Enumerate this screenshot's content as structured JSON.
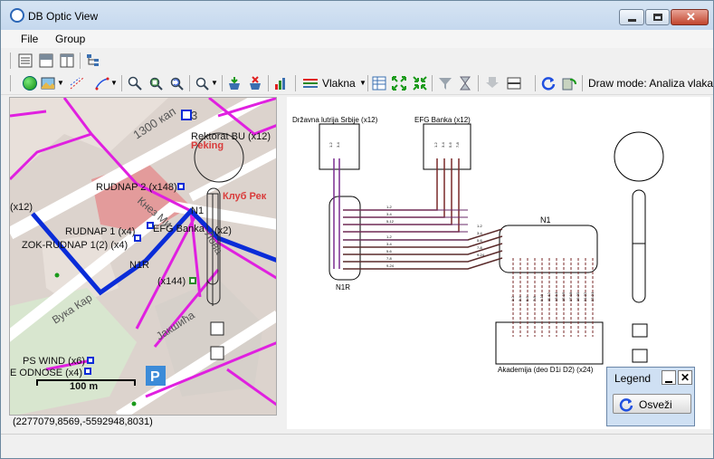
{
  "window": {
    "title": "DB Optic View"
  },
  "menu": [
    {
      "label": "File"
    },
    {
      "label": "Group"
    }
  ],
  "toolbar": {
    "vlakna_label": "Vlakna",
    "draw_mode": "Draw mode: Analiza vlaka"
  },
  "map": {
    "labels": {
      "rektorat": "Rektorat BU (x12)",
      "rudnap2": "RUDNAP 2 (x148)",
      "rudnap1": "RUDNAP 1 (x4)",
      "zok": "ZOK-RUDNAP 1(2) (x4)",
      "efg": "EFG Banka",
      "n1": "N1",
      "n1r": "N1R",
      "x144": "(x144)",
      "x12left": "(x12)",
      "x2": "(x2)",
      "pswind": "PS WIND (x6)",
      "odnose": "E ODNOSE (x4)",
      "num3": "3",
      "peking": "Peking",
      "klub": "Клуб Рек",
      "street1": "1300 кап",
      "street2": "Кнез Ми",
      "street3": "Вука Кар",
      "street4": "Јакшића",
      "street5": "Лова",
      "scale": "100 m"
    },
    "coordinates": "(2277079,8569,-5592948,8031)"
  },
  "schematic": {
    "nodes": {
      "lutrija": "Državna lutrija Srbije (x12)",
      "efg": "EFG Banka (x12)",
      "n1": "N1",
      "n1r": "N1R",
      "akademija": "Akademija (deo D1i D2) (x24)"
    },
    "fiber_labels": [
      "1-2",
      "3-4",
      "5-12",
      "1-2",
      "3-4",
      "5-6",
      "7-8",
      "9-24"
    ],
    "n1_labels": [
      "1-2",
      "3-4",
      "5-6",
      "7-8",
      "9-24"
    ],
    "lutrija_ports": [
      "1-2",
      "3-4"
    ],
    "efg_ports": [
      "1-2",
      "3-4",
      "5-6",
      "7-8"
    ],
    "akademija_ports": [
      "1-2",
      "3-4",
      "5-6",
      "7-8",
      "9-10",
      "11-12",
      "13-14",
      "15-16",
      "17-18",
      "19-20",
      "21-22",
      "23-24"
    ]
  },
  "legend": {
    "title": "Legend",
    "refresh_label": "Osveži"
  },
  "colors": {
    "accent_blue": "#2b66b6",
    "fiber_purple": "#7a2d91",
    "fiber_brown": "#7a2a2a",
    "map_route": "#e020e0",
    "map_cable": "#0a2cd8"
  }
}
